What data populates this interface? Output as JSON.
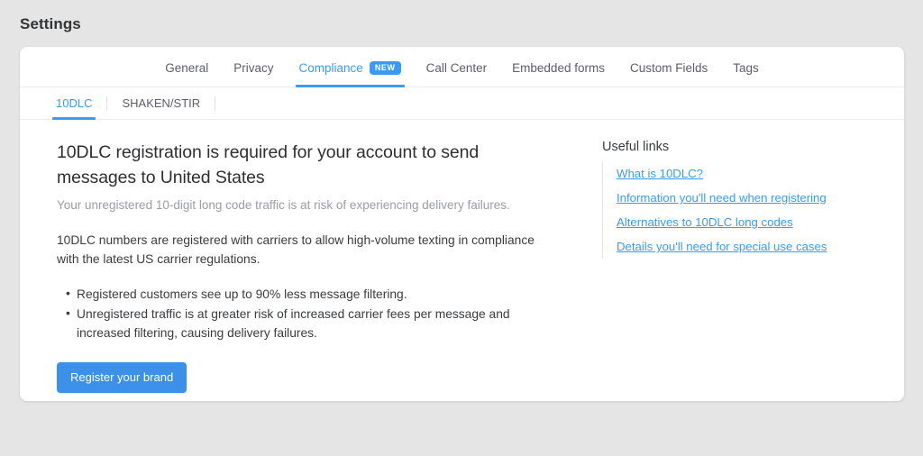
{
  "page": {
    "title": "Settings"
  },
  "primary_tabs": [
    {
      "label": "General",
      "active": false,
      "badge": null
    },
    {
      "label": "Privacy",
      "active": false,
      "badge": null
    },
    {
      "label": "Compliance",
      "active": true,
      "badge": "NEW"
    },
    {
      "label": "Call Center",
      "active": false,
      "badge": null
    },
    {
      "label": "Embedded forms",
      "active": false,
      "badge": null
    },
    {
      "label": "Custom Fields",
      "active": false,
      "badge": null
    },
    {
      "label": "Tags",
      "active": false,
      "badge": null
    }
  ],
  "secondary_tabs": [
    {
      "label": "10DLC",
      "active": true
    },
    {
      "label": "SHAKEN/STIR",
      "active": false
    }
  ],
  "content": {
    "heading": "10DLC registration is required for your account to send messages to United States",
    "subheading": "Your unregistered 10-digit long code traffic is at risk of experiencing delivery failures.",
    "paragraph": "10DLC numbers are registered with carriers to allow high-volume texting in compliance with the latest US carrier regulations.",
    "bullets": [
      "Registered customers see up to 90% less message filtering.",
      "Unregistered traffic is at greater risk of increased carrier fees per message and increased filtering, causing delivery failures."
    ],
    "primary_button": "Register your brand"
  },
  "useful_links": {
    "title": "Useful links",
    "items": [
      "What is 10DLC?",
      "Information you'll need when registering",
      "Alternatives to 10DLC long codes",
      "Details you'll need for special use cases"
    ]
  },
  "colors": {
    "accent": "#3c9bf0",
    "button": "#3c90e8",
    "page_background": "#e5e5e5",
    "card_background": "#ffffff",
    "text_primary": "#3a3c3f",
    "text_muted": "#9a9ea3"
  }
}
